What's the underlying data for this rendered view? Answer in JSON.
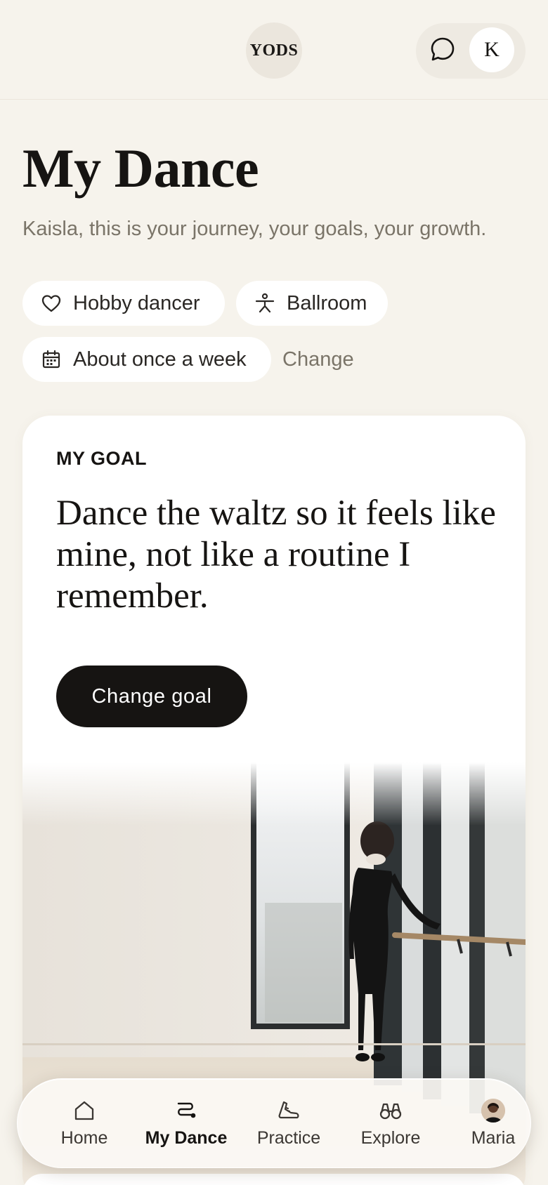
{
  "header": {
    "logo_text": "YODS",
    "chat_icon": "chat-bubble-icon",
    "avatar_initial": "K"
  },
  "page": {
    "title": "My Dance",
    "subtitle": "Kaisla, this is your journey, your goals, your growth."
  },
  "chips": {
    "hobby": {
      "icon": "heart-icon",
      "label": "Hobby dancer"
    },
    "style": {
      "icon": "dancer-icon",
      "label": "Ballroom"
    },
    "frequency": {
      "icon": "calendar-icon",
      "label": "About once a week"
    },
    "change_label": "Change"
  },
  "goal": {
    "eyebrow": "MY GOAL",
    "text": "Dance the waltz so it feels like mine, not like a routine I remember.",
    "button_label": "Change goal"
  },
  "nav": {
    "items": [
      {
        "label": "Home",
        "icon": "home-icon",
        "active": false
      },
      {
        "label": "My Dance",
        "icon": "path-icon",
        "active": true
      },
      {
        "label": "Practice",
        "icon": "shoe-icon",
        "active": false
      },
      {
        "label": "Explore",
        "icon": "binoculars-icon",
        "active": false
      },
      {
        "label": "Maria",
        "icon": "profile-photo",
        "active": false
      }
    ]
  },
  "colors": {
    "background": "#f6f3ec",
    "card": "#ffffff",
    "primary_button": "#161412",
    "muted_text": "#7a7468"
  }
}
